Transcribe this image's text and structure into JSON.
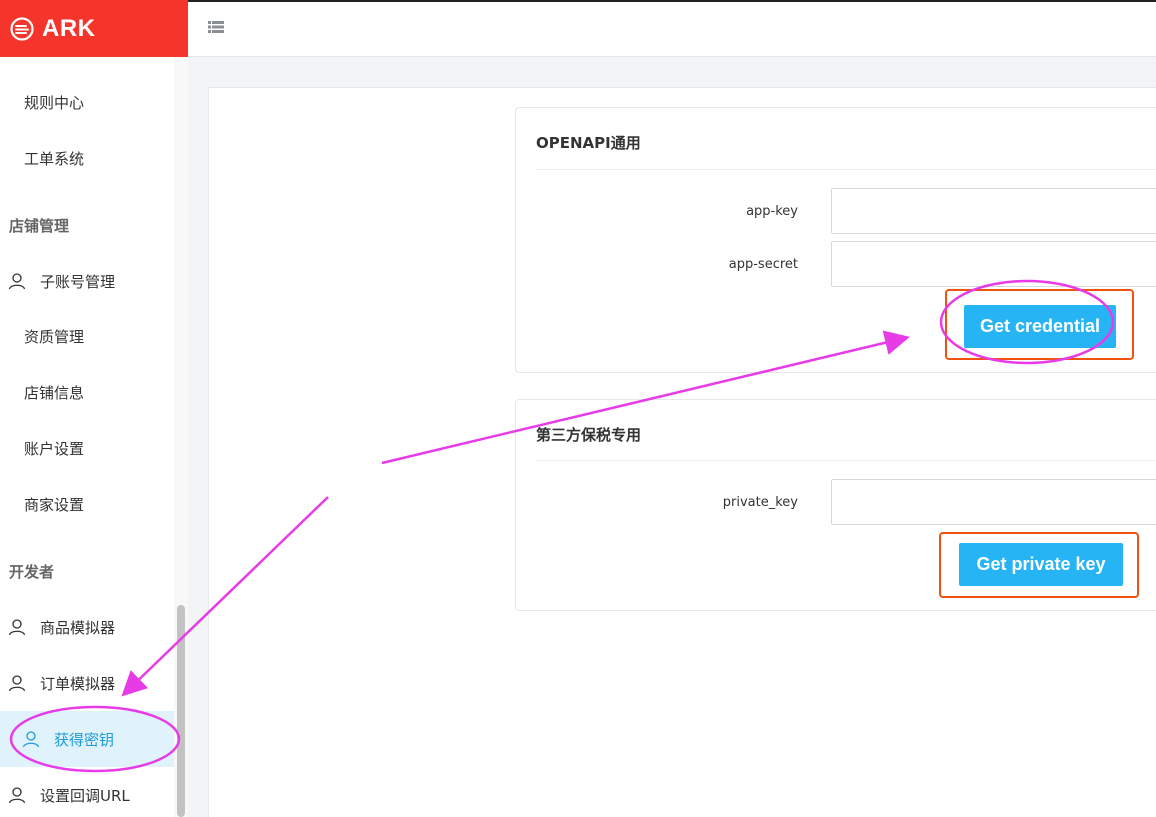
{
  "brand": {
    "name": "ARK",
    "color": "#f5352c"
  },
  "topbar": {
    "menu_icon": "list-icon"
  },
  "sidebar": {
    "items_top": [
      {
        "label": "规则中心"
      },
      {
        "label": "工单系统"
      }
    ],
    "group_store": "店铺管理",
    "items_store": [
      {
        "label": "子账号管理",
        "icon": "user-icon"
      },
      {
        "label": "资质管理"
      },
      {
        "label": "店铺信息"
      },
      {
        "label": "账户设置"
      },
      {
        "label": "商家设置"
      }
    ],
    "group_dev": "开发者",
    "items_dev": [
      {
        "label": "商品模拟器",
        "icon": "user-icon"
      },
      {
        "label": "订单模拟器",
        "icon": "user-icon"
      },
      {
        "label": "获得密钥",
        "icon": "user-icon",
        "active": true
      },
      {
        "label": "设置回调URL",
        "icon": "user-icon"
      }
    ]
  },
  "openapi_card": {
    "title": "OPENAPI通用",
    "app_key_label": "app-key",
    "app_key_value": "",
    "app_secret_label": "app-secret",
    "app_secret_value": "",
    "button": "Get credential"
  },
  "bonded_card": {
    "title": "第三方保税专用",
    "private_key_label": "private_key",
    "private_key_value": "",
    "button": "Get private key"
  },
  "colors": {
    "accent": "#27b4f5",
    "active_text": "#1e9bdb",
    "annotation_magenta": "#e83be8",
    "annotation_orange": "#f0530f"
  }
}
